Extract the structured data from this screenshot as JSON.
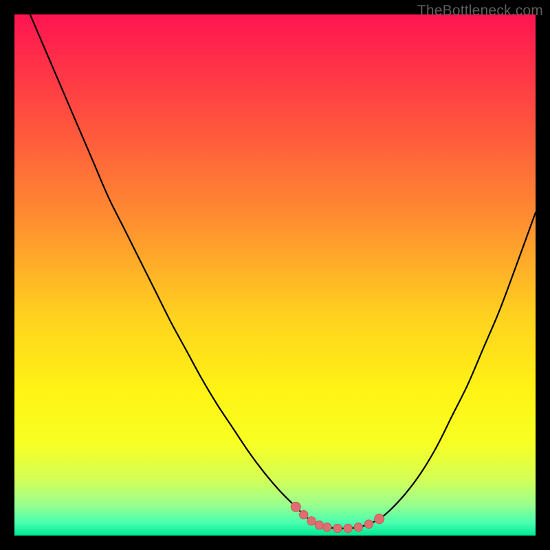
{
  "watermark": "TheBottleneck.com",
  "colors": {
    "frame": "#000000",
    "curve_stroke": "#000000",
    "marker_fill": "#de6e6f",
    "marker_stroke": "#c75a5b",
    "watermark_text": "#5f5f5f",
    "gradient_stops": [
      {
        "offset": 0.0,
        "color": "#ff1451"
      },
      {
        "offset": 0.2,
        "color": "#ff503f"
      },
      {
        "offset": 0.4,
        "color": "#ff9030"
      },
      {
        "offset": 0.58,
        "color": "#ffd21f"
      },
      {
        "offset": 0.72,
        "color": "#fff315"
      },
      {
        "offset": 0.82,
        "color": "#f8ff22"
      },
      {
        "offset": 0.89,
        "color": "#d6ff54"
      },
      {
        "offset": 0.94,
        "color": "#9bff8d"
      },
      {
        "offset": 0.975,
        "color": "#4affb0"
      },
      {
        "offset": 1.0,
        "color": "#00e893"
      }
    ]
  },
  "chart_data": {
    "type": "line",
    "title": "",
    "xlabel": "",
    "ylabel": "",
    "xlim": [
      0,
      100
    ],
    "ylim": [
      0,
      100
    ],
    "grid": false,
    "legend": false,
    "series": [
      {
        "name": "bottleneck-curve",
        "x": [
          0,
          3,
          6,
          9,
          12,
          15,
          18,
          21,
          24,
          27,
          30,
          33,
          36,
          39,
          42,
          45,
          48,
          51,
          54,
          55.5,
          57,
          58.5,
          60,
          62,
          64,
          66,
          68,
          70,
          72,
          75,
          78,
          81,
          84,
          87,
          90,
          93,
          96,
          100
        ],
        "y": [
          107,
          100,
          93,
          86,
          79,
          72,
          65,
          59,
          53,
          47,
          41,
          35.5,
          30,
          25,
          20.5,
          16,
          12,
          8.5,
          5.5,
          4,
          2.8,
          2,
          1.6,
          1.4,
          1.4,
          1.6,
          2.2,
          3.2,
          4.8,
          8,
          12,
          17,
          23,
          29,
          36,
          43,
          51,
          62
        ]
      }
    ],
    "markers": {
      "name": "highlight-segment",
      "x": [
        54,
        55.5,
        57,
        58.5,
        60,
        62,
        64,
        66,
        68,
        70
      ],
      "y": [
        5.5,
        4,
        2.8,
        2,
        1.6,
        1.4,
        1.4,
        1.6,
        2.2,
        3.2
      ]
    }
  }
}
